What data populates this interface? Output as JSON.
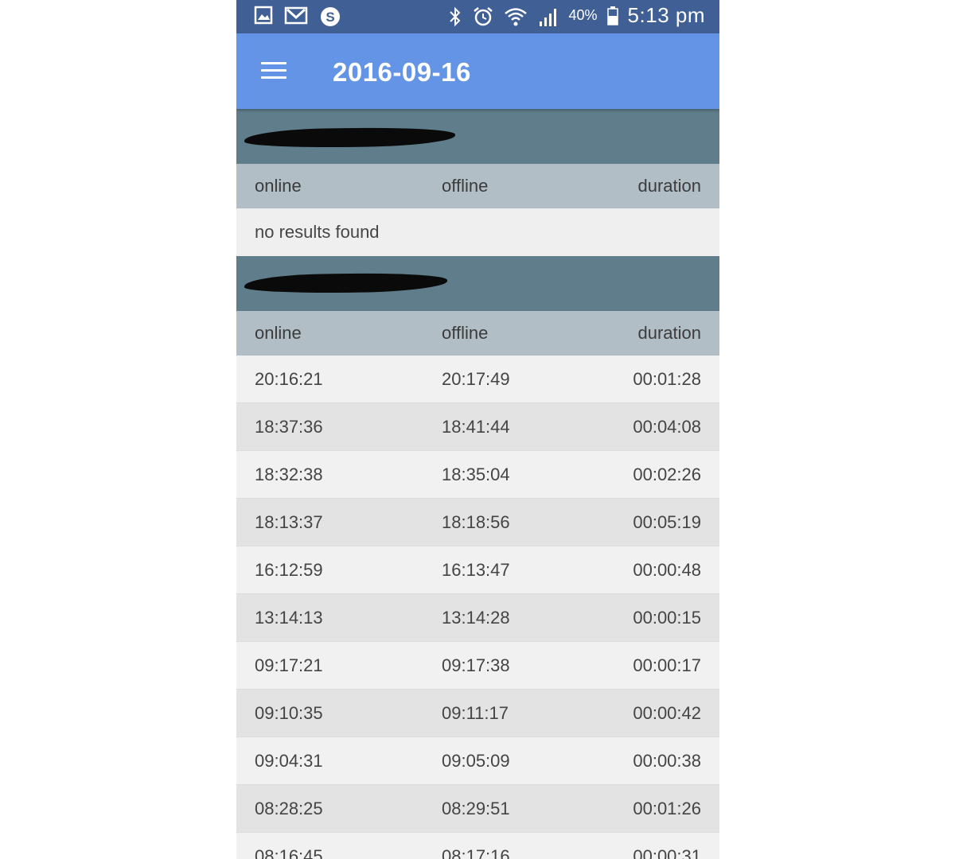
{
  "status_bar": {
    "icons_left": [
      "gallery-icon",
      "gmail-icon",
      "skype-icon"
    ],
    "icons_right": [
      "bluetooth-icon",
      "alarm-icon",
      "wifi-icon",
      "signal-icon"
    ],
    "battery": "40%",
    "time": "5:13 pm"
  },
  "app_bar": {
    "title": "2016-09-16",
    "menu_icon": "hamburger-menu-icon",
    "color": "#6394e6"
  },
  "sections": [
    {
      "name_redacted": true,
      "columns": [
        "online",
        "offline",
        "duration"
      ],
      "empty_text": "no results found"
    },
    {
      "name_redacted": true,
      "columns": [
        "online",
        "offline",
        "duration"
      ],
      "rows": [
        {
          "online": "20:16:21",
          "offline": "20:17:49",
          "duration": "00:01:28"
        },
        {
          "online": "18:37:36",
          "offline": "18:41:44",
          "duration": "00:04:08"
        },
        {
          "online": "18:32:38",
          "offline": "18:35:04",
          "duration": "00:02:26"
        },
        {
          "online": "18:13:37",
          "offline": "18:18:56",
          "duration": "00:05:19"
        },
        {
          "online": "16:12:59",
          "offline": "16:13:47",
          "duration": "00:00:48"
        },
        {
          "online": "13:14:13",
          "offline": "13:14:28",
          "duration": "00:00:15"
        },
        {
          "online": "09:17:21",
          "offline": "09:17:38",
          "duration": "00:00:17"
        },
        {
          "online": "09:10:35",
          "offline": "09:11:17",
          "duration": "00:00:42"
        },
        {
          "online": "09:04:31",
          "offline": "09:05:09",
          "duration": "00:00:38"
        },
        {
          "online": "08:28:25",
          "offline": "08:29:51",
          "duration": "00:01:26"
        },
        {
          "online": "08:16:45",
          "offline": "08:17:16",
          "duration": "00:00:31"
        }
      ]
    }
  ]
}
